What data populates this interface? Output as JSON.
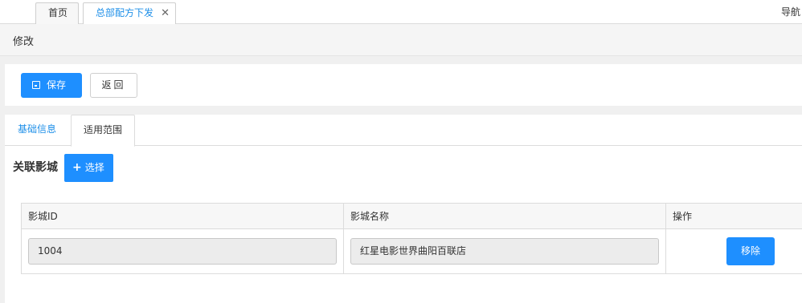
{
  "tabs": {
    "home": "首页",
    "active": "总部配方下发",
    "close_glyph": "✕"
  },
  "nav_text": "导航",
  "page_title": "修改",
  "toolbar": {
    "save_label": "保存",
    "back_label": "返回"
  },
  "subtabs": {
    "basic": "基础信息",
    "scope": "适用范围"
  },
  "section": {
    "label": "关联影城",
    "select_label": "选择"
  },
  "table": {
    "headers": [
      "影城ID",
      "影城名称",
      "操作"
    ],
    "rows": [
      {
        "id": "1004",
        "name": "红星电影世界曲阳百联店",
        "action": "移除"
      }
    ]
  },
  "colors": {
    "primary": "#1e8fff",
    "link": "#1e8fe8"
  }
}
